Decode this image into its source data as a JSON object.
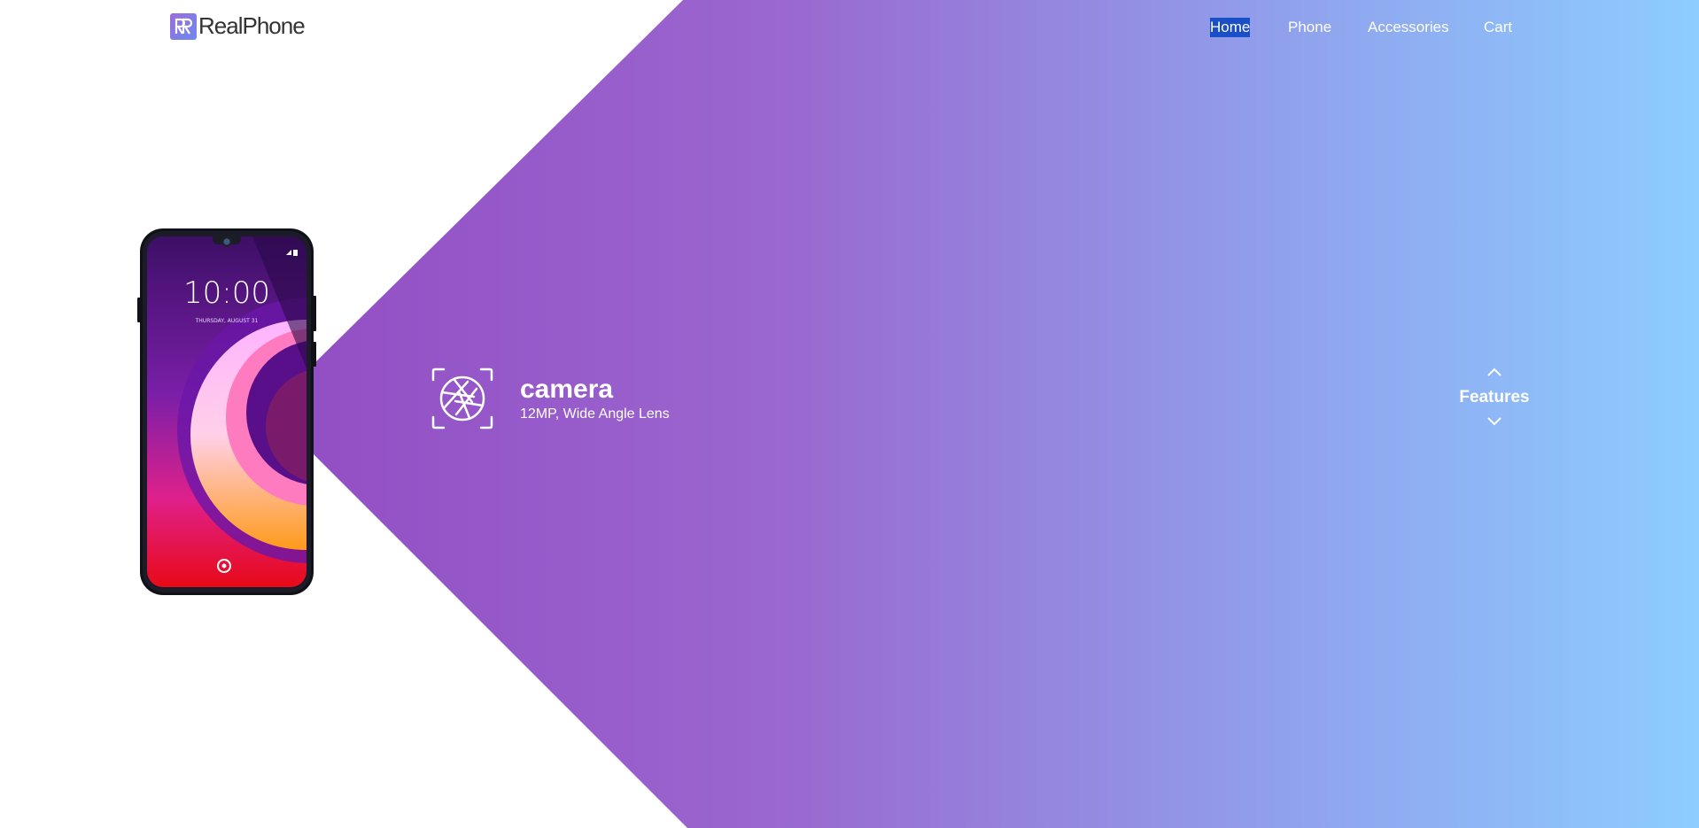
{
  "brand": {
    "name": "RealPhone",
    "logo_icon": "rp-monogram-icon"
  },
  "nav": {
    "items": [
      {
        "label": "Home",
        "active": true
      },
      {
        "label": "Phone",
        "active": false
      },
      {
        "label": "Accessories",
        "active": false
      },
      {
        "label": "Cart",
        "active": false
      }
    ]
  },
  "phone": {
    "time": "10:00",
    "date": "THURSDAY, AUGUST 31"
  },
  "feature": {
    "icon": "camera-aperture-icon",
    "title": "camera",
    "description": "12MP, Wide Angle Lens"
  },
  "features_nav": {
    "label": "Features",
    "up_icon": "chevron-up-icon",
    "down_icon": "chevron-down-icon"
  },
  "colors": {
    "gradient_start": "#8e3fbd",
    "gradient_end": "#8dcdff",
    "nav_active_bg": "#1a4fc8",
    "logo_text": "#333333"
  }
}
